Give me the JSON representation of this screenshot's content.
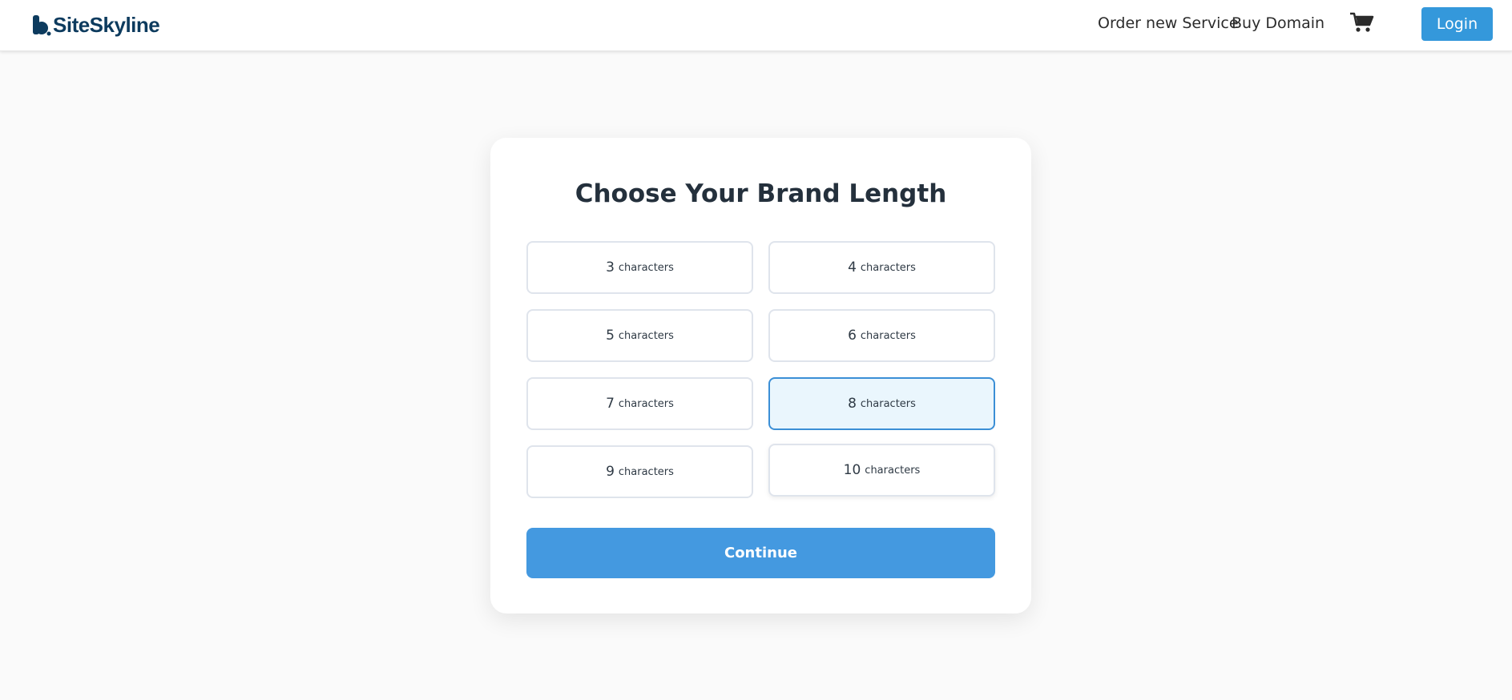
{
  "header": {
    "logo_text": "SiteSkyline",
    "nav": {
      "order_label": "Order new Service",
      "domain_label": "Buy Domain"
    },
    "cart_icon": "shopping-cart-icon",
    "login_label": "Login"
  },
  "card": {
    "title": "Choose Your Brand Length",
    "options": [
      {
        "num": "3",
        "unit": "characters",
        "selected": false
      },
      {
        "num": "4",
        "unit": "characters",
        "selected": false
      },
      {
        "num": "5",
        "unit": "characters",
        "selected": false
      },
      {
        "num": "6",
        "unit": "characters",
        "selected": false
      },
      {
        "num": "7",
        "unit": "characters",
        "selected": false
      },
      {
        "num": "8",
        "unit": "characters",
        "selected": true
      },
      {
        "num": "9",
        "unit": "characters",
        "selected": false
      },
      {
        "num": "10",
        "unit": "characters",
        "selected": false
      }
    ],
    "continue_label": "Continue"
  },
  "colors": {
    "brand": "#0d3b5e",
    "accent": "#3498db",
    "selected_bg": "#eaf6fd",
    "selected_border": "#3b8fd6"
  }
}
